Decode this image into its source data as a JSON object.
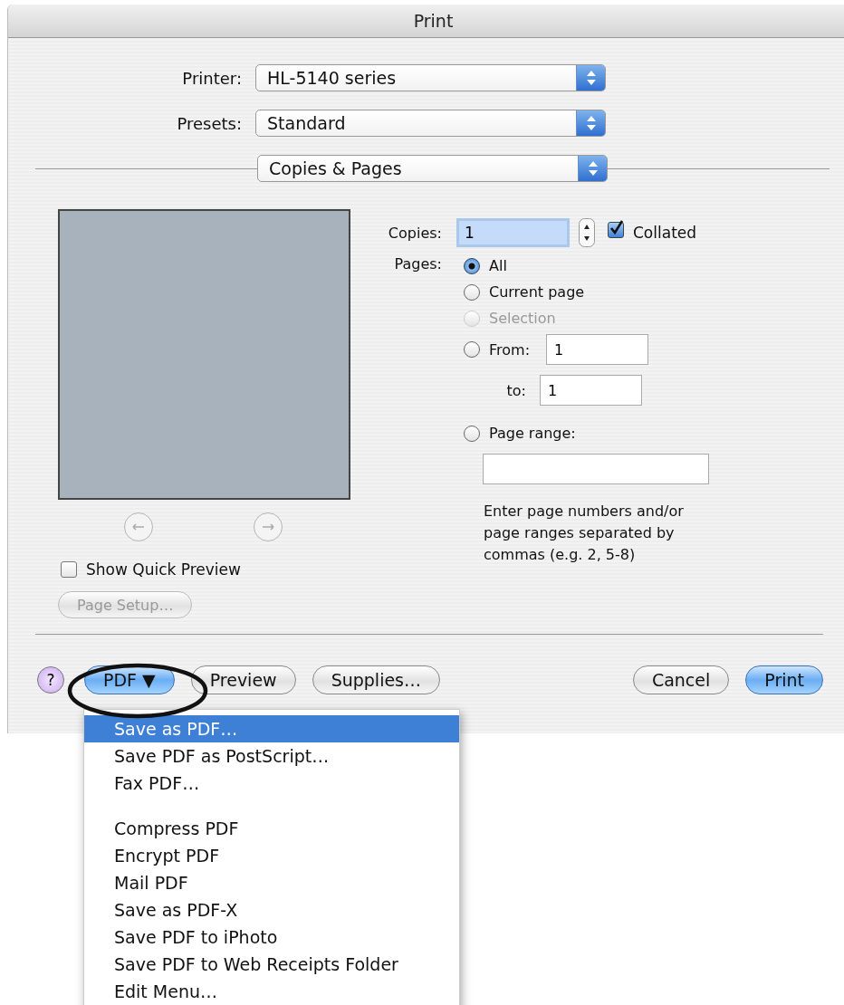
{
  "window": {
    "title": "Print"
  },
  "printer": {
    "label": "Printer:",
    "value": "HL-5140 series"
  },
  "presets": {
    "label": "Presets:",
    "value": "Standard"
  },
  "panel_menu": {
    "value": "Copies & Pages"
  },
  "preview": {
    "show_quick_preview": {
      "label": "Show Quick Preview",
      "checked": false
    },
    "page_setup": {
      "label": "Page Setup…",
      "disabled": true
    }
  },
  "copies": {
    "label": "Copies:",
    "value": "1",
    "collated": {
      "label": "Collated",
      "checked": true
    }
  },
  "pages": {
    "label": "Pages:",
    "options": [
      {
        "kind": "plain",
        "label": "All",
        "selected": true,
        "disabled": false
      },
      {
        "kind": "plain",
        "label": "Current page",
        "selected": false,
        "disabled": false
      },
      {
        "kind": "plain",
        "label": "Selection",
        "selected": false,
        "disabled": true
      },
      {
        "kind": "from",
        "label": "From:",
        "value": "1",
        "to_label": "to:",
        "to_value": "1",
        "selected": false,
        "disabled": false
      },
      {
        "kind": "range",
        "label": "Page range:",
        "hint": "Enter page numbers and/or page ranges separated by commas (e.g. 2, 5-8)",
        "selected": false,
        "disabled": false
      }
    ]
  },
  "buttons": [
    {
      "kind": "help",
      "label": "?"
    },
    {
      "kind": "menu",
      "label": "PDF ▼",
      "default": true
    },
    {
      "kind": "plain",
      "label": "Preview",
      "default": false
    },
    {
      "kind": "plain",
      "label": "Supplies…",
      "default": false
    },
    {
      "kind": "spacer"
    },
    {
      "kind": "plain",
      "label": "Cancel",
      "default": false
    },
    {
      "kind": "plain",
      "label": "Print",
      "default": true
    }
  ],
  "pdf_menu": {
    "items": [
      {
        "kind": "item",
        "label": "Save as PDF…",
        "selected": true
      },
      {
        "kind": "item",
        "label": "Save PDF as PostScript…",
        "selected": false
      },
      {
        "kind": "item",
        "label": "Fax PDF…",
        "selected": false
      },
      {
        "kind": "separator"
      },
      {
        "kind": "item",
        "label": "Compress PDF",
        "selected": false
      },
      {
        "kind": "item",
        "label": "Encrypt PDF",
        "selected": false
      },
      {
        "kind": "item",
        "label": "Mail PDF",
        "selected": false
      },
      {
        "kind": "item",
        "label": "Save as PDF-X",
        "selected": false
      },
      {
        "kind": "item",
        "label": "Save PDF to iPhoto",
        "selected": false
      },
      {
        "kind": "item",
        "label": "Save PDF to Web Receipts Folder",
        "selected": false
      },
      {
        "kind": "item",
        "label": "Edit Menu…",
        "selected": false
      }
    ]
  }
}
